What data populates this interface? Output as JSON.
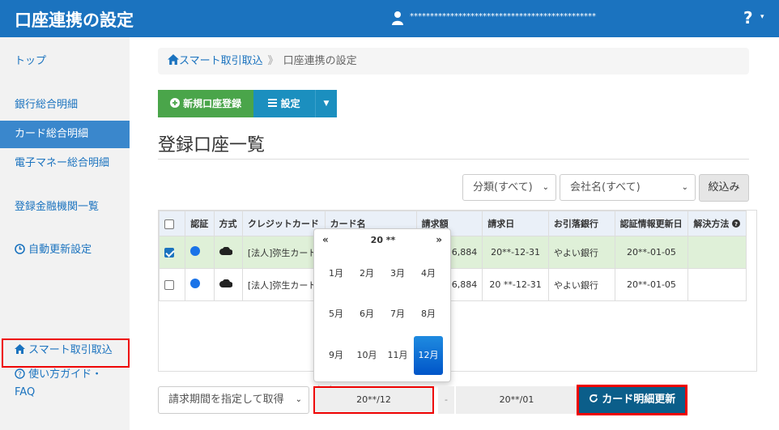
{
  "header": {
    "title": "口座連携の設定",
    "user_name": "**********************************************",
    "help_label": "?",
    "help_caret": "▾"
  },
  "sidebar": {
    "items": [
      {
        "label": "トップ"
      },
      {
        "label": "銀行総合明細"
      },
      {
        "label": "カード総合明細"
      },
      {
        "label": "電子マネー総合明細"
      },
      {
        "label": "登録金融機関一覧"
      },
      {
        "label": "自動更新設定"
      },
      {
        "label": "スマート取引取込"
      },
      {
        "label": "使い方ガイド・"
      },
      {
        "label": "FAQ"
      }
    ]
  },
  "breadcrumb": {
    "home": "スマート取引取込",
    "separator": "》",
    "current": "口座連携の設定"
  },
  "toolbar": {
    "new_label": "新規口座登録",
    "settings_label": "設定"
  },
  "section_title": "登録口座一覧",
  "filters": {
    "category": "分類(すべて)",
    "company": "会社名(すべて)",
    "filter_button": "絞込み"
  },
  "table": {
    "headers": [
      "認証",
      "方式",
      "クレジットカード",
      "カード名",
      "請求額",
      "請求日",
      "お引落銀行",
      "認証情報更新日",
      "解決方法"
    ],
    "rows": [
      {
        "card": "[法人]弥生カード",
        "amount": "6,884",
        "date": "20**-12-31",
        "bank": "やよい銀行",
        "updated": "20**-01-05"
      },
      {
        "card": "[法人]弥生カード",
        "amount": "6,884",
        "date": "20 **-12-31",
        "bank": "やよい銀行",
        "updated": "20**-01-05"
      }
    ]
  },
  "picker": {
    "prev": "«",
    "next": "»",
    "year": "20 **",
    "months": [
      "1月",
      "2月",
      "3月",
      "4月",
      "5月",
      "6月",
      "7月",
      "8月",
      "9月",
      "10月",
      "11月",
      "12月"
    ],
    "selected_month": 12
  },
  "period": {
    "select_label": "請求期間を指定して取得",
    "from": "20**/12",
    "dash": "-",
    "to": "20**/01",
    "refresh_label": "カード明細更新"
  },
  "colors": {
    "header_blue": "#1b73bf",
    "success_green": "#4aa54a",
    "highlight_red": "#e00000",
    "refresh_button": "#0b5e8a"
  }
}
